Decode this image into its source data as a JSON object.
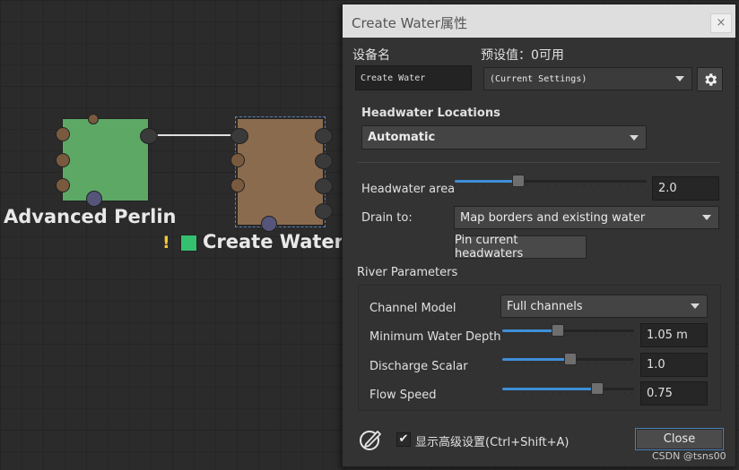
{
  "graph": {
    "node1_label": "Advanced Perlin",
    "node2_label": "Create Water",
    "warning_glyph": "!",
    "node1_color": "#5ea865",
    "node2_color": "#8b6b4e",
    "swatch_color": "#35c070"
  },
  "dialog": {
    "title": "Create Water属性",
    "close_glyph": "×",
    "device_name_label": "设备名",
    "device_name_value": "Create Water",
    "preset_label": "预设值：0可用",
    "preset_value": "(Current Settings)",
    "headwater_section": "Headwater Locations",
    "headwater_mode": "Automatic",
    "headwater_area_label": "Headwater area",
    "headwater_area_value": "2.0",
    "headwater_area_level": 0.33,
    "drain_label": "Drain to:",
    "drain_value": "Map borders and existing water",
    "pin_button": "Pin current headwaters",
    "river_section": "River Parameters",
    "channel_model_label": "Channel Model",
    "channel_model_value": "Full channels",
    "min_depth_label": "Minimum Water Depth",
    "min_depth_value": "1.05 m",
    "min_depth_level": 0.42,
    "discharge_label": "Discharge Scalar",
    "discharge_value": "1.0",
    "discharge_level": 0.52,
    "flow_label": "Flow Speed",
    "flow_value": "0.75",
    "flow_level": 0.72,
    "advanced_label": "显示高级设置(Ctrl+Shift+A)",
    "advanced_checked": "✔",
    "close_button": "Close",
    "accent_color": "#3f8fd8"
  },
  "watermark": "CSDN @tsns00"
}
